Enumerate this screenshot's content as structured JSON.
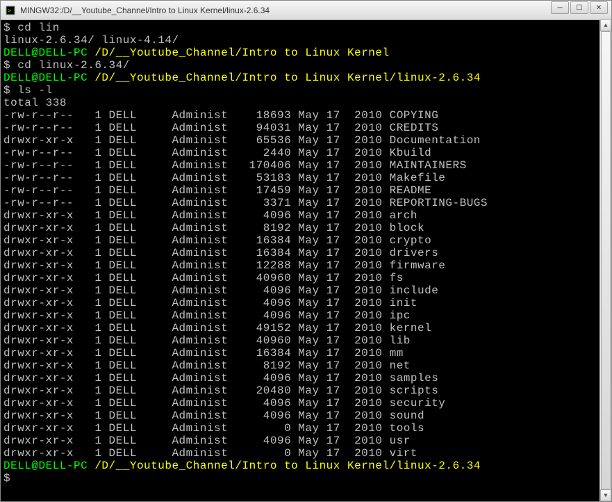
{
  "window": {
    "title": "MINGW32:/D/__Youtube_Channel/Intro to Linux Kernel/linux-2.6.34"
  },
  "prompt": {
    "user": "DELL@DELL-PC",
    "path1": "/D/__Youtube_Channel/Intro to Linux Kernel",
    "path2": "/D/__Youtube_Channel/Intro to Linux Kernel/linux-2.6.34",
    "dollar": "$"
  },
  "cmds": {
    "cd_lin": "cd lin",
    "tabcomplete": "linux-2.6.34/ linux-4.14/",
    "cd_full": "cd linux-2.6.34/",
    "ls": "ls -l",
    "total": "total 338"
  },
  "cols": {
    "links": "1",
    "owner": "DELL",
    "group": "Administ",
    "month": "May",
    "day": "17",
    "year": "2010"
  },
  "files": [
    {
      "perm": "-rw-r--r--",
      "size": "18693",
      "name": "COPYING"
    },
    {
      "perm": "-rw-r--r--",
      "size": "94031",
      "name": "CREDITS"
    },
    {
      "perm": "drwxr-xr-x",
      "size": "65536",
      "name": "Documentation"
    },
    {
      "perm": "-rw-r--r--",
      "size": "2440",
      "name": "Kbuild"
    },
    {
      "perm": "-rw-r--r--",
      "size": "170406",
      "name": "MAINTAINERS"
    },
    {
      "perm": "-rw-r--r--",
      "size": "53183",
      "name": "Makefile"
    },
    {
      "perm": "-rw-r--r--",
      "size": "17459",
      "name": "README"
    },
    {
      "perm": "-rw-r--r--",
      "size": "3371",
      "name": "REPORTING-BUGS"
    },
    {
      "perm": "drwxr-xr-x",
      "size": "4096",
      "name": "arch"
    },
    {
      "perm": "drwxr-xr-x",
      "size": "8192",
      "name": "block"
    },
    {
      "perm": "drwxr-xr-x",
      "size": "16384",
      "name": "crypto"
    },
    {
      "perm": "drwxr-xr-x",
      "size": "16384",
      "name": "drivers"
    },
    {
      "perm": "drwxr-xr-x",
      "size": "12288",
      "name": "firmware"
    },
    {
      "perm": "drwxr-xr-x",
      "size": "40960",
      "name": "fs"
    },
    {
      "perm": "drwxr-xr-x",
      "size": "4096",
      "name": "include"
    },
    {
      "perm": "drwxr-xr-x",
      "size": "4096",
      "name": "init"
    },
    {
      "perm": "drwxr-xr-x",
      "size": "4096",
      "name": "ipc"
    },
    {
      "perm": "drwxr-xr-x",
      "size": "49152",
      "name": "kernel"
    },
    {
      "perm": "drwxr-xr-x",
      "size": "40960",
      "name": "lib"
    },
    {
      "perm": "drwxr-xr-x",
      "size": "16384",
      "name": "mm"
    },
    {
      "perm": "drwxr-xr-x",
      "size": "8192",
      "name": "net"
    },
    {
      "perm": "drwxr-xr-x",
      "size": "4096",
      "name": "samples"
    },
    {
      "perm": "drwxr-xr-x",
      "size": "20480",
      "name": "scripts"
    },
    {
      "perm": "drwxr-xr-x",
      "size": "4096",
      "name": "security"
    },
    {
      "perm": "drwxr-xr-x",
      "size": "4096",
      "name": "sound"
    },
    {
      "perm": "drwxr-xr-x",
      "size": "0",
      "name": "tools"
    },
    {
      "perm": "drwxr-xr-x",
      "size": "4096",
      "name": "usr"
    },
    {
      "perm": "drwxr-xr-x",
      "size": "0",
      "name": "virt"
    }
  ]
}
